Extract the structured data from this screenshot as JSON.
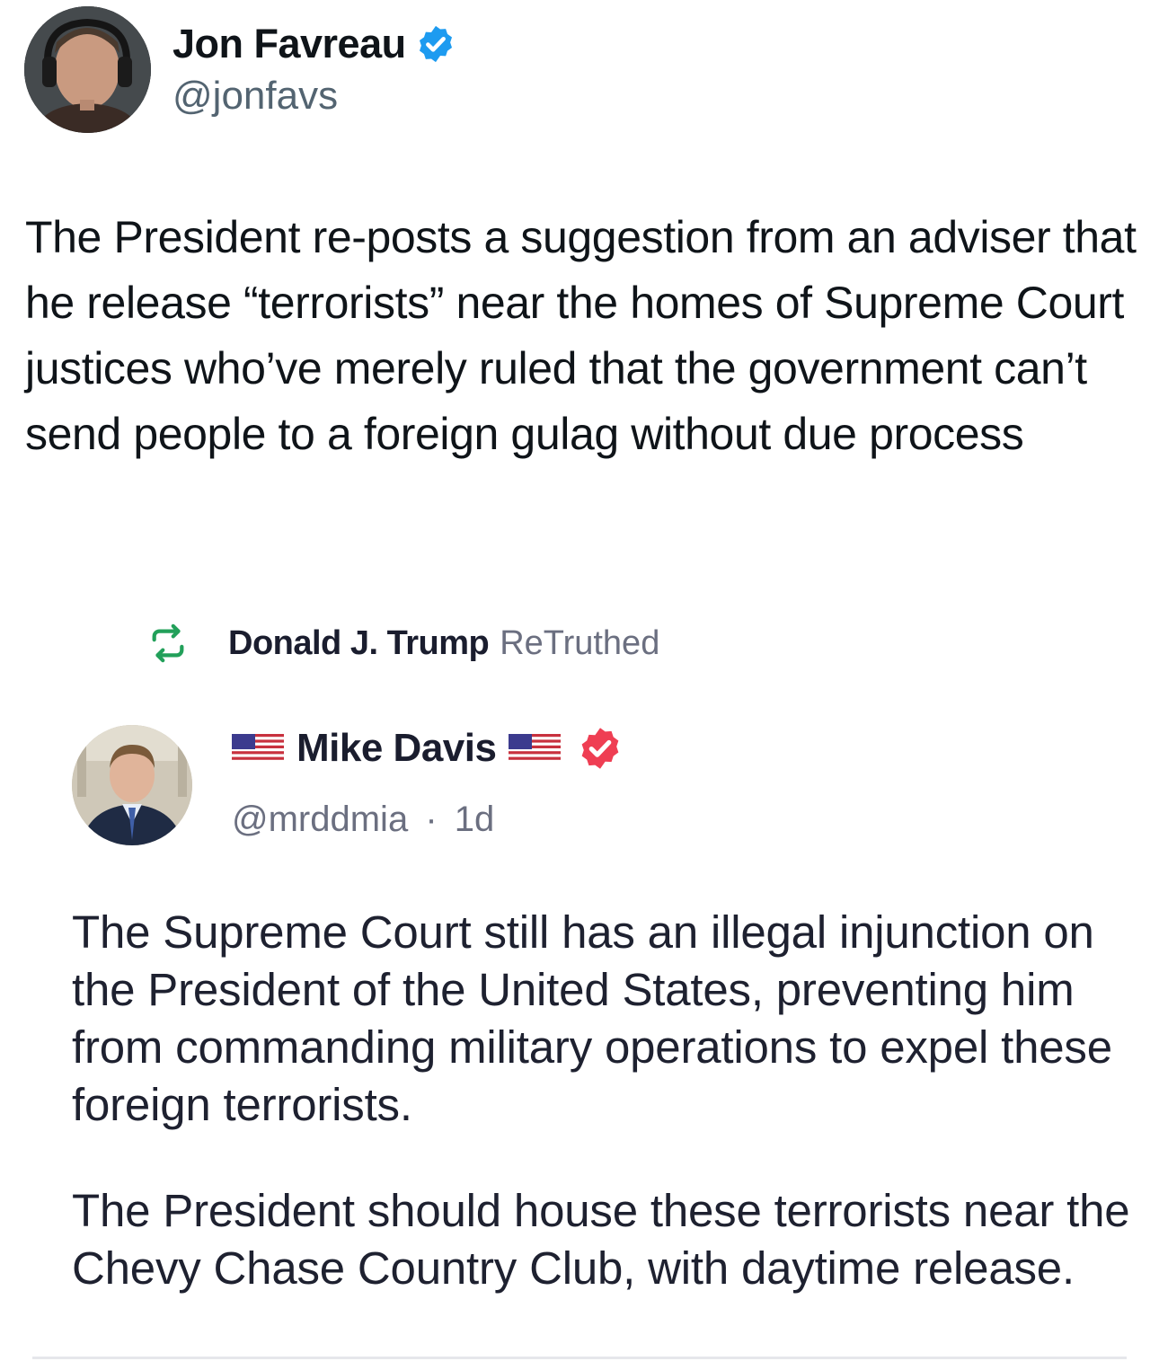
{
  "tweet": {
    "author_name": "Jon Favreau",
    "author_handle": "@jonfavs",
    "text": "The President re-posts a suggestion from an adviser that he release “terrorists” near the homes of Supreme Court justices who’ve merely ruled that the government can’t send people to a foreign gulag without due process",
    "verified_badge_color": "#1d9bf0"
  },
  "embedded_post": {
    "repost_user": "Donald J. Trump",
    "repost_label": "ReTruthed",
    "repost_icon_color": "#22a05a",
    "author_name": "Mike Davis",
    "author_handle": "@mrddmia",
    "separator": "·",
    "age": "1d",
    "verified_badge_color": "#ef3e53",
    "paragraphs": [
      "The Supreme Court still has an illegal injunction on the President of the United States, preventing him from commanding military operations to expel these foreign terrorists.",
      "The President should house these terrorists near the Chevy Chase Country Club, with daytime release."
    ]
  }
}
